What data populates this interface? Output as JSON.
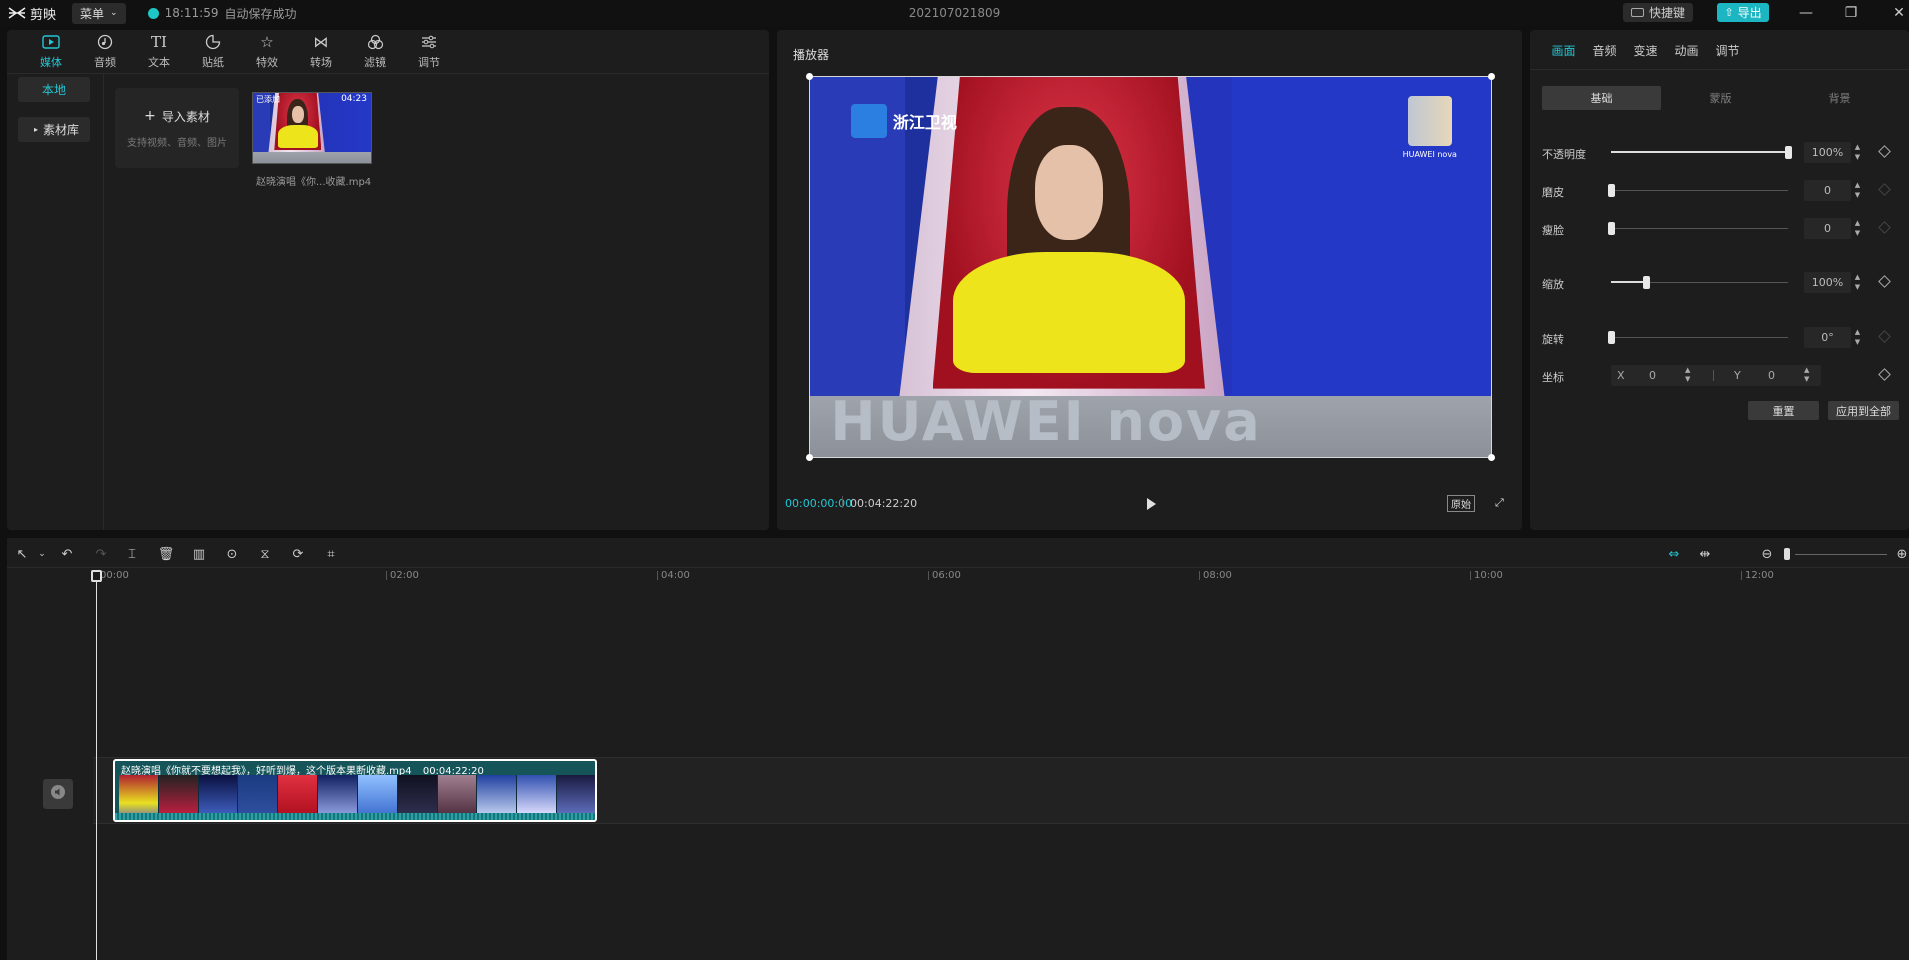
{
  "app": {
    "name": "剪映",
    "menu_label": "菜单",
    "save_time": "18:11:59",
    "save_status": "自动保存成功",
    "doc_title": "202107021809",
    "shortcut_label": "快捷键",
    "export_label": "导出"
  },
  "media": {
    "tabs": [
      {
        "label": "媒体",
        "icon": "media-icon"
      },
      {
        "label": "音频",
        "icon": "audio-icon"
      },
      {
        "label": "文本",
        "icon": "text-icon"
      },
      {
        "label": "贴纸",
        "icon": "sticker-icon"
      },
      {
        "label": "特效",
        "icon": "effects-icon"
      },
      {
        "label": "转场",
        "icon": "transition-icon"
      },
      {
        "label": "滤镜",
        "icon": "filter-icon"
      },
      {
        "label": "调节",
        "icon": "adjust-icon"
      }
    ],
    "side": {
      "local": "本地",
      "library": "素材库"
    },
    "import_label": "导入素材",
    "import_hint": "支持视频、音频、图片",
    "clip": {
      "duration": "04:23",
      "badge": "已添加",
      "name": "赵晓演唱《你...收藏.mp4"
    }
  },
  "player": {
    "title": "播放器",
    "time_current": "00:00:00:00",
    "time_total": "00:04:22:20",
    "ratio_label": "原始",
    "channel_logo": "浙江卫视",
    "brand_tag": "HUAWEI nova",
    "desk_text": "HUAWEI nova"
  },
  "properties": {
    "tabs": [
      "画面",
      "音频",
      "变速",
      "动画",
      "调节"
    ],
    "segments": [
      "基础",
      "蒙版",
      "背景"
    ],
    "rows": [
      {
        "label": "不透明度",
        "value": "100%",
        "level": 1.0
      },
      {
        "label": "磨皮",
        "value": "0",
        "level": 0
      },
      {
        "label": "瘦脸",
        "value": "0",
        "level": 0
      },
      {
        "label": "缩放",
        "value": "100%",
        "level": 0.2
      },
      {
        "label": "旋转",
        "value": "0°",
        "level": 0
      }
    ],
    "coord_label": "坐标",
    "x_label": "X",
    "x_value": "0",
    "y_label": "Y",
    "y_value": "0",
    "reset_label": "重置",
    "apply_all_label": "应用到全部"
  },
  "timeline": {
    "ticks": [
      "00:00",
      "02:00",
      "04:00",
      "06:00",
      "08:00",
      "10:00",
      "12:00"
    ],
    "clip_title": "赵晓演唱《你就不要想起我》，好听到爆，这个版本果断收藏.mp4",
    "clip_duration": "00:04:22:20"
  },
  "colors": {
    "accent": "#23c6d3",
    "clip": "#15555a"
  }
}
